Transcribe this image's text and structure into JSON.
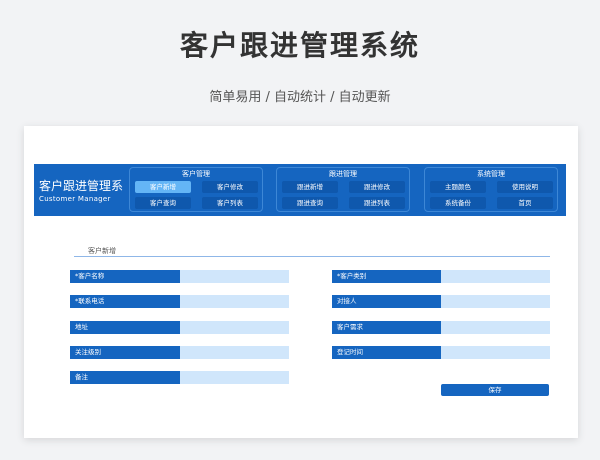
{
  "header": {
    "title": "客户跟进管理系统",
    "subtitle": "简单易用  /  自动统计  /  自动更新"
  },
  "app": {
    "title": "客户跟进管理系",
    "subtitle": "Customer Manager"
  },
  "menu": {
    "groups": [
      {
        "title": "客户管理",
        "items": [
          "客户新增",
          "客户修改",
          "客户查询",
          "客户列表"
        ]
      },
      {
        "title": "跟进管理",
        "items": [
          "跟进新增",
          "跟进修改",
          "跟进查询",
          "跟进列表"
        ]
      },
      {
        "title": "系统管理",
        "items": [
          "主题颜色",
          "使用说明",
          "系统备份",
          "首页"
        ]
      }
    ],
    "active": "客户新增"
  },
  "form": {
    "section_title": "客户新增",
    "fields": {
      "name": "*客户名称",
      "type": "*客户类别",
      "phone": "*联系电话",
      "contact": "对接人",
      "address": "地址",
      "demand": "客户需求",
      "level": "关注级别",
      "date": "登记时间",
      "note": "备注"
    },
    "values": {
      "name": "",
      "type": "",
      "phone": "",
      "contact": "",
      "address": "",
      "demand": "",
      "level": "",
      "date": "",
      "note": ""
    },
    "save_label": "保存"
  },
  "colors": {
    "primary": "#1565c0",
    "input_bg": "#d0e6fb",
    "active_menu": "#64b5f6"
  }
}
